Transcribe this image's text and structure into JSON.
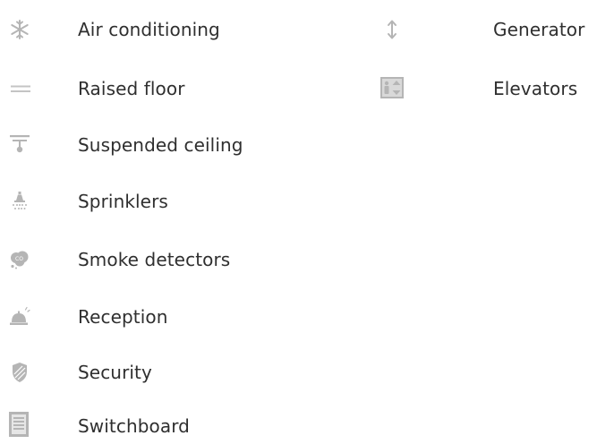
{
  "amenities": {
    "left": [
      {
        "label": "Air conditioning",
        "icon": "snowflake-icon"
      },
      {
        "label": "Raised floor",
        "icon": "raised-floor-icon"
      },
      {
        "label": "Suspended ceiling",
        "icon": "suspended-ceiling-icon"
      },
      {
        "label": "Sprinklers",
        "icon": "sprinkler-icon"
      },
      {
        "label": "Smoke detectors",
        "icon": "smoke-detector-icon"
      },
      {
        "label": "Reception",
        "icon": "reception-bell-icon"
      },
      {
        "label": "Security",
        "icon": "shield-icon"
      },
      {
        "label": "Switchboard",
        "icon": "switchboard-icon"
      }
    ],
    "right": [
      {
        "label": "Generator",
        "icon": "generator-arrow-icon"
      },
      {
        "label": "Elevators",
        "icon": "elevator-icon"
      }
    ]
  },
  "colors": {
    "icon": "#b5b5b5",
    "text": "#2f2f2f"
  }
}
